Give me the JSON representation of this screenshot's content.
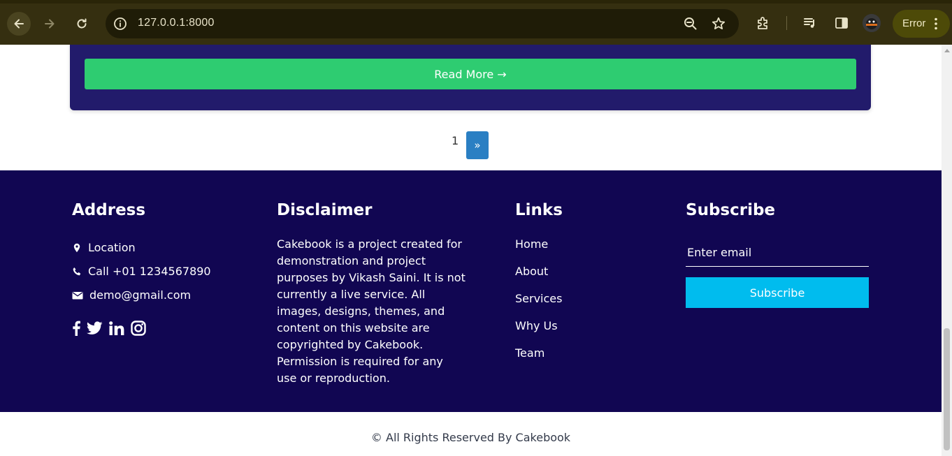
{
  "browser": {
    "url": "127.0.0.1:8000",
    "error_label": "Error"
  },
  "card": {
    "read_more_label": "Read More →"
  },
  "pagination": {
    "current_page": "1",
    "next_label": "»"
  },
  "footer": {
    "address": {
      "title": "Address",
      "location": "Location",
      "phone": "Call +01 1234567890",
      "email": "demo@gmail.com"
    },
    "disclaimer": {
      "title": "Disclaimer",
      "text": "Cakebook is a project created for demonstration and project purposes by Vikash Saini. It is not currently a live service. All images, designs, themes, and content on this website are copyrighted by Cakebook. Permission is required for any use or reproduction."
    },
    "links": {
      "title": "Links",
      "items": [
        "Home",
        "About",
        "Services",
        "Why Us",
        "Team"
      ]
    },
    "subscribe": {
      "title": "Subscribe",
      "placeholder": "Enter email",
      "button_label": "Subscribe"
    }
  },
  "copyright": "© All Rights Reserved By Cakebook",
  "colors": {
    "card_bg": "#221b6b",
    "read_more_bg": "#2ecc71",
    "footer_bg": "#110652",
    "pager_active": "#2a7fc3",
    "subscribe_bg": "#00bcee"
  }
}
